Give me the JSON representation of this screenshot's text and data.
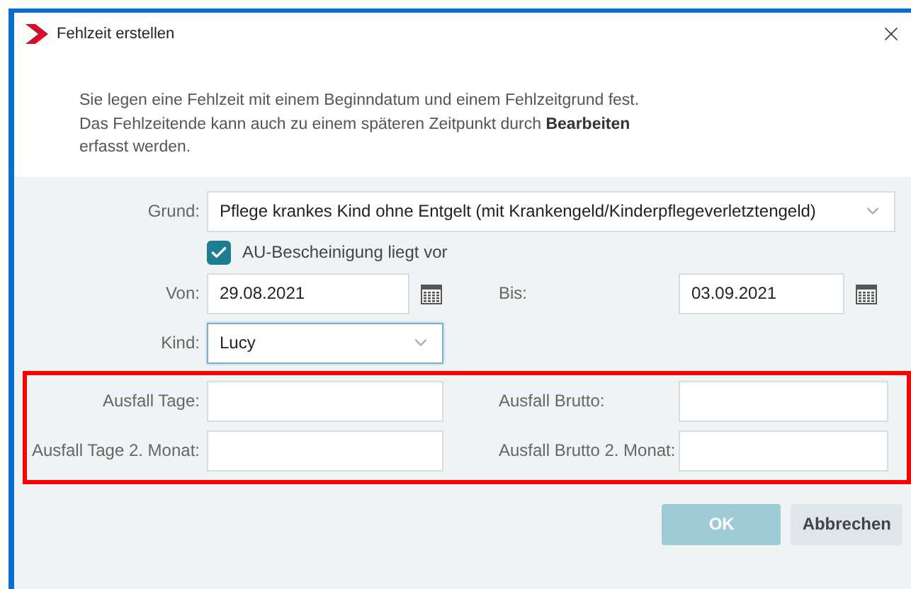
{
  "window": {
    "title": "Fehlzeit erstellen"
  },
  "intro": "Sie legen eine Fehlzeit mit einem Beginndatum und einem Fehlzeitgrund fest.\nDas Fehlzeitende kann auch zu einem späteren Zeitpunkt durch **Bearbeiten**\nerfasst werden.",
  "grund": {
    "label": "Grund:",
    "value": "Pflege krankes Kind ohne Entgelt (mit Krankengeld/Kinderpflegeverletztengeld)"
  },
  "au": {
    "label": "AU-Bescheinigung liegt vor",
    "checked": true
  },
  "von": {
    "label": "Von:",
    "value": "29.08.2021"
  },
  "bis": {
    "label": "Bis:",
    "value": "03.09.2021"
  },
  "kind": {
    "label": "Kind:",
    "value": "Lucy",
    "focused": true
  },
  "ausfall": [
    {
      "label": "Ausfall Tage:"
    },
    {
      "label": "Ausfall Brutto:"
    },
    {
      "label": "Ausfall Tage 2. Monat:"
    },
    {
      "label": "Ausfall Brutto 2. Monat:"
    }
  ],
  "buttons": [
    {
      "label": "OK",
      "disabled": true
    },
    {
      "label": "Abbrechen",
      "disabled": false
    }
  ]
}
